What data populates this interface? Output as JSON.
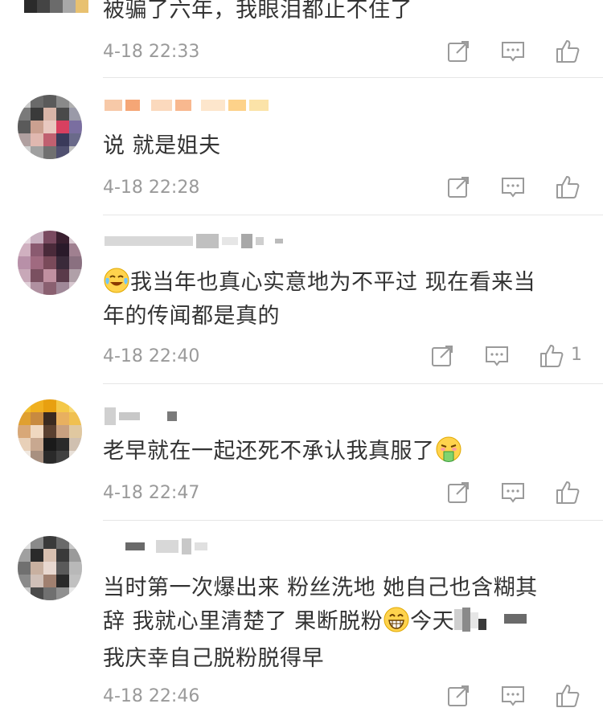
{
  "comments": [
    {
      "text": "被骗了六年，我眼泪都止不住了",
      "time": "4-18 22:33",
      "likes": ""
    },
    {
      "text": "说 就是姐夫",
      "time": "4-18 22:28",
      "likes": ""
    },
    {
      "text_a": "我当年也真心实意地为不平过 现在看来当",
      "text_b": "年的传闻都是真的",
      "time": "4-18 22:40",
      "likes": "1"
    },
    {
      "text": "老早就在一起还死不承认我真服了",
      "time": "4-18 22:47",
      "likes": ""
    },
    {
      "text_a": "当时第一次爆出来 粉丝洗地 她自己也含糊其",
      "text_b1": "辞 我就心里清楚了 果断脱粉",
      "text_b2": "今天",
      "text_c": "我庆幸自己脱粉脱得早",
      "time": "4-18 22:46",
      "likes": ""
    }
  ],
  "icons": {
    "share": "share-icon",
    "comment": "comment-icon",
    "like": "like-icon",
    "crying_emoji": "crying-laughing-emoji",
    "vomit_emoji": "vomit-emoji",
    "grin_emoji": "grin-emoji"
  },
  "colors": {
    "text": "#333333",
    "meta": "#9a9a9a",
    "divider": "#e6e6e6"
  }
}
